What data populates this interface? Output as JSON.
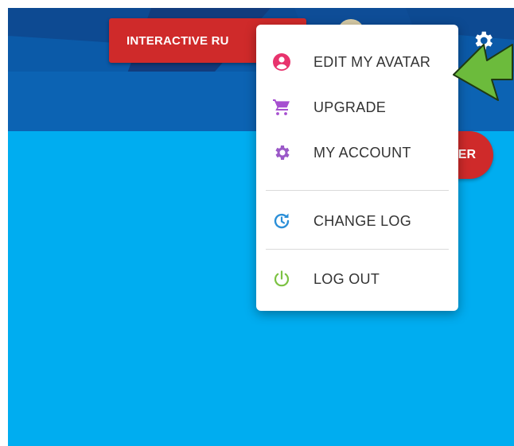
{
  "header": {
    "rules_button_label": "INTERACTIVE RU",
    "red_pill_label": "ER"
  },
  "menu": {
    "items": [
      {
        "label": "EDIT MY AVATAR",
        "icon": "account-circle-icon",
        "color": "#e8336d"
      },
      {
        "label": "UPGRADE",
        "icon": "cart-icon",
        "color": "#a64fd0"
      },
      {
        "label": "MY ACCOUNT",
        "icon": "gear-icon",
        "color": "#9b59c8"
      },
      {
        "label": "CHANGE LOG",
        "icon": "history-icon",
        "color": "#2b8fd8"
      },
      {
        "label": "LOG OUT",
        "icon": "power-icon",
        "color": "#7cc243"
      }
    ]
  },
  "colors": {
    "app_bg": "#00adf0",
    "header_blue": "#0a4f9e",
    "button_red": "#cf2a2a",
    "arrow_green": "#6cbb3c"
  }
}
